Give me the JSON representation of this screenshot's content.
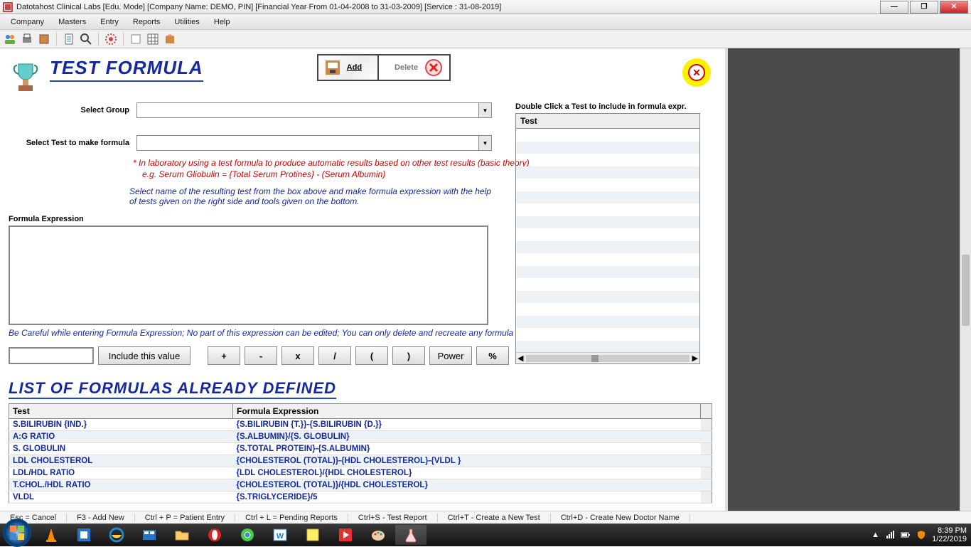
{
  "window": {
    "title": "Datotahost Clinical Labs [Edu. Mode] [Company Name: DEMO, PIN] [Financial Year From 01-04-2008 to 31-03-2009]  [Service : 31-08-2019]"
  },
  "menubar": [
    "Company",
    "Masters",
    "Entry",
    "Reports",
    "Utilities",
    "Help"
  ],
  "page": {
    "title": "TEST FORMULA",
    "add_label": "Add",
    "delete_label": "Delete",
    "select_group_label": "Select Group",
    "select_test_label": "Select Test to make formula",
    "help1": "* In laboratory using a test formula to produce automatic results based on other test results (basic theory)",
    "help2": "e.g. Serum Gliobulin = {Total Serum Protines} - (Serum Albumin)",
    "help3": "Select name of the resulting test from the box above and make formula expression with the help of tests given on the right side and tools given on the bottom.",
    "fe_label": "Formula Expression",
    "fe_warn": "Be Careful while entering Formula Expression; No part of this expression can be edited;  You can only delete and recreate any formula",
    "include_label": "Include this value",
    "ops": {
      "plus": "+",
      "minus": "-",
      "mul": "x",
      "div": "/",
      "lp": "(",
      "rp": ")",
      "pow": "Power",
      "pct": "%"
    },
    "test_hint": "Double Click a Test to include in formula expr.",
    "test_header": "Test",
    "list_title": "LIST OF FORMULAS ALREADY DEFINED",
    "def_headers": {
      "test": "Test",
      "expr": "Formula Expression"
    },
    "def_rows": [
      {
        "test": "S.BILIRUBIN {IND.}",
        "expr": "{S.BILIRUBIN {T.}}-{S.BILIRUBIN {D.}}"
      },
      {
        "test": "A:G RATIO",
        "expr": "{S.ALBUMIN}/{S. GLOBULIN}"
      },
      {
        "test": "S. GLOBULIN",
        "expr": "{S.TOTAL PROTEIN}-{S.ALBUMIN}"
      },
      {
        "test": "LDL CHOLESTEROL",
        "expr": "{CHOLESTEROL (TOTAL)}-{HDL CHOLESTEROL}-{VLDL }"
      },
      {
        "test": "LDL/HDL RATIO",
        "expr": "{LDL CHOLESTEROL}/{HDL CHOLESTEROL}"
      },
      {
        "test": "T.CHOL./HDL RATIO",
        "expr": "{CHOLESTEROL (TOTAL)}/{HDL CHOLESTEROL}"
      },
      {
        "test": "VLDL",
        "expr": "{S.TRIGLYCERIDE}/5"
      }
    ]
  },
  "status": [
    "Esc = Cancel",
    "F3 - Add New",
    "Ctrl + P = Patient Entry",
    "Ctrl + L = Pending Reports",
    "Ctrl+S  - Test Report",
    "Ctrl+T  -  Create a New Test",
    "Ctrl+D - Create New Doctor Name"
  ],
  "tray": {
    "time": "8:39 PM",
    "date": "1/22/2019"
  }
}
